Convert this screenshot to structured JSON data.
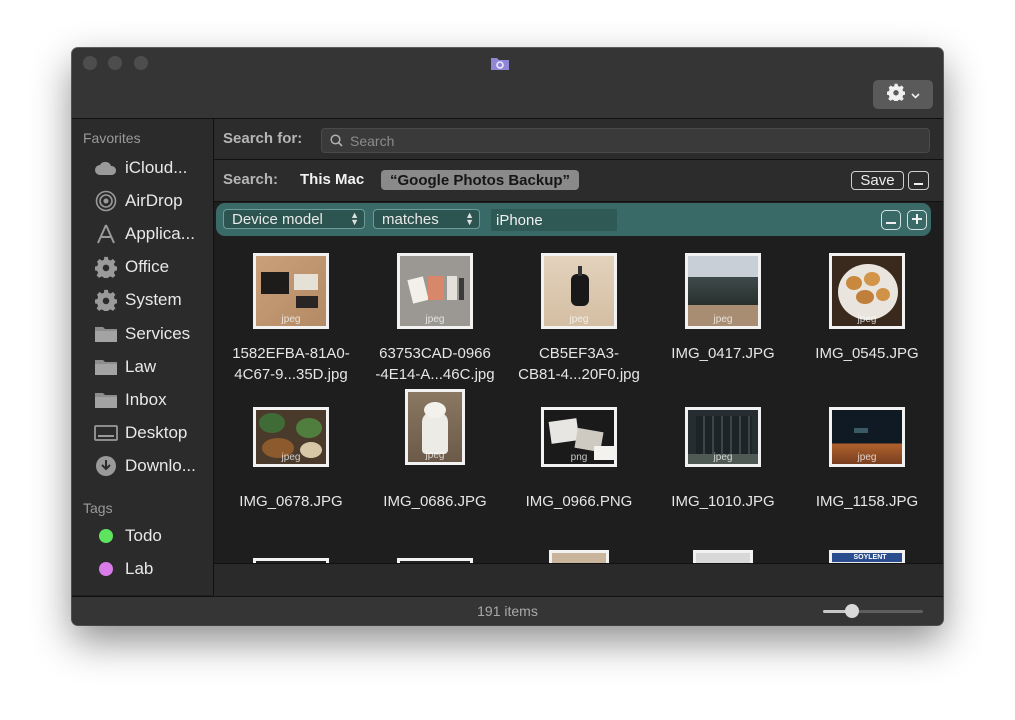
{
  "sidebar": {
    "favorites_header": "Favorites",
    "favorites": [
      {
        "label": "iCloud...",
        "icon": "cloud-icon"
      },
      {
        "label": "AirDrop",
        "icon": "airdrop-icon"
      },
      {
        "label": "Applica...",
        "icon": "applications-icon"
      },
      {
        "label": "Office",
        "icon": "gear-icon"
      },
      {
        "label": "System",
        "icon": "gear-icon"
      },
      {
        "label": "Services",
        "icon": "folder-icon"
      },
      {
        "label": "Law",
        "icon": "folder-icon"
      },
      {
        "label": "Inbox",
        "icon": "folder-icon"
      },
      {
        "label": "Desktop",
        "icon": "desktop-icon"
      },
      {
        "label": "Downlo...",
        "icon": "download-icon"
      }
    ],
    "tags_header": "Tags",
    "tags": [
      {
        "label": "Todo",
        "color": "#5fe35f"
      },
      {
        "label": "Lab",
        "color": "#d77ce8"
      }
    ]
  },
  "search": {
    "label": "Search for:",
    "placeholder": "Search",
    "value": ""
  },
  "scope": {
    "label": "Search:",
    "this_mac": "This Mac",
    "selected": "“Google Photos Backup”",
    "save_label": "Save",
    "remove_label": "−"
  },
  "rule": {
    "attribute": "Device model",
    "operator": "matches",
    "value": "iPhone",
    "remove_label": "−",
    "add_label": "+"
  },
  "files": [
    {
      "name_line1": "1582EFBA-81A0-",
      "name_line2": "4C67-9...35D.jpg",
      "ext": "jpeg"
    },
    {
      "name_line1": "63753CAD-0966",
      "name_line2": "-4E14-A...46C.jpg",
      "ext": "jpeg"
    },
    {
      "name_line1": "CB5EF3A3-",
      "name_line2": "CB81-4...20F0.jpg",
      "ext": "jpeg"
    },
    {
      "name_line1": "IMG_0417.JPG",
      "name_line2": "",
      "ext": "jpeg"
    },
    {
      "name_line1": "IMG_0545.JPG",
      "name_line2": "",
      "ext": "jpeg"
    },
    {
      "name_line1": "IMG_0678.JPG",
      "name_line2": "",
      "ext": "jpeg"
    },
    {
      "name_line1": "IMG_0686.JPG",
      "name_line2": "",
      "ext": "jpeg"
    },
    {
      "name_line1": "IMG_0966.PNG",
      "name_line2": "",
      "ext": "png"
    },
    {
      "name_line1": "IMG_1010.JPG",
      "name_line2": "",
      "ext": "jpeg"
    },
    {
      "name_line1": "IMG_1158.JPG",
      "name_line2": "",
      "ext": "jpeg"
    }
  ],
  "partial_thumb_text": "SOYLENT",
  "status": {
    "item_count": "191 items",
    "zoom_level": 0.25
  }
}
